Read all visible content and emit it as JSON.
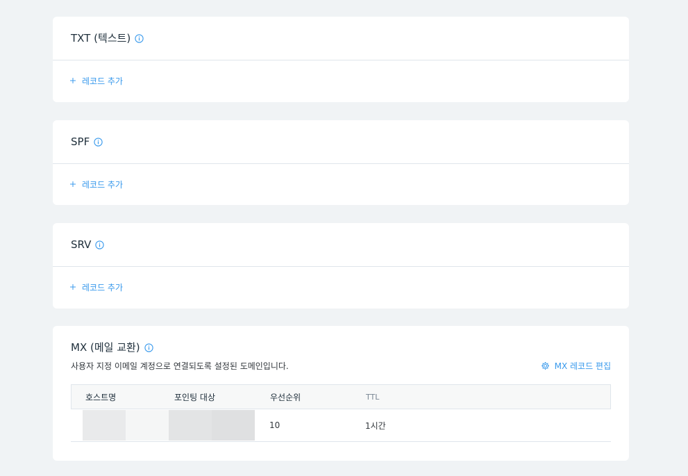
{
  "cards": [
    {
      "title": "TXT (텍스트)",
      "add_label": "레코드 추가"
    },
    {
      "title": "SPF",
      "add_label": "레코드 추가"
    },
    {
      "title": "SRV",
      "add_label": "레코드 추가"
    }
  ],
  "mx": {
    "title": "MX (메일 교환)",
    "subtitle": "사용자 지정 이메일 계정으로 연결되도록 설정된 도메인입니다.",
    "edit_label": "MX 레코드 편집",
    "headers": [
      "호스트명",
      "포인팅 대상",
      "우선순위",
      "TTL"
    ],
    "rows": [
      {
        "priority": "10",
        "ttl": "1시간"
      }
    ]
  },
  "colors": {
    "accent": "#3899ec",
    "background": "#f0f3f5",
    "card": "#ffffff",
    "border": "#dfe5eb"
  },
  "icons": [
    "info-icon",
    "plus-icon",
    "gear-icon"
  ]
}
